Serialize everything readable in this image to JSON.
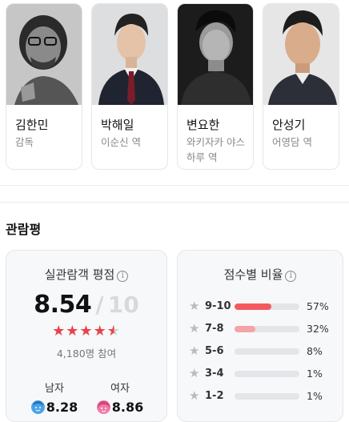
{
  "cast": [
    {
      "name": "김한민",
      "role": "감독"
    },
    {
      "name": "박해일",
      "role": "이순신 역"
    },
    {
      "name": "변요한",
      "role": "와키자카 야스하루 역"
    },
    {
      "name": "안성기",
      "role": "어영담 역"
    }
  ],
  "reviews": {
    "title": "관람평",
    "audience": {
      "heading": "실관람객 평점",
      "info_icon": "i",
      "score": "8.54",
      "separator": "/",
      "max": "10",
      "stars_value": 4.27,
      "stars_max": 5,
      "participants": "4,180명 참여",
      "male_label": "남자",
      "male_score": "8.28",
      "female_label": "여자",
      "female_score": "8.86"
    },
    "distribution": {
      "heading": "점수별 비율",
      "info_icon": "i",
      "rows": [
        {
          "label": "9-10",
          "percent": 57,
          "percent_text": "57%"
        },
        {
          "label": "7-8",
          "percent": 32,
          "percent_text": "32%"
        },
        {
          "label": "5-6",
          "percent": 8,
          "percent_text": "8%"
        },
        {
          "label": "3-4",
          "percent": 1,
          "percent_text": "1%"
        },
        {
          "label": "1-2",
          "percent": 1,
          "percent_text": "1%"
        }
      ]
    }
  },
  "colors": {
    "accent_red": "#e8424a",
    "bar_top": "#f25a5f",
    "bar_second": "#f4a3a6",
    "bar_track": "#e3e5e9",
    "male_icon": "#4aa3e8",
    "female_icon": "#f07aa8"
  }
}
